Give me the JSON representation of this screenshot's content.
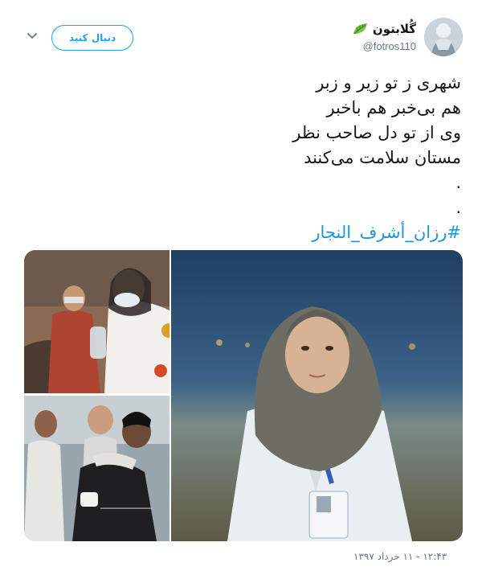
{
  "author": {
    "display_name": "گُلابتون",
    "handle": "@fotros110",
    "badge_icon": "leaf-icon",
    "avatar_icon": "avatar-photo"
  },
  "actions": {
    "follow_label": "دنبال کنید",
    "menu_icon": "chevron-down-icon"
  },
  "tweet": {
    "lines": [
      "شهری ز تو زیر و زبر",
      "هم بی‌خبر هم باخبر",
      "وی از تو دل صاحب نظر",
      "مستان سلامت می‌کنند",
      ".",
      "."
    ],
    "hashtag": "#رزان_أشرف_النجار",
    "timestamp": "۱۲:۴۳ - ۱۱ خرداد ۱۳۹۷"
  },
  "media": {
    "images": [
      "photo-portrait-medic",
      "photo-medic-field",
      "photo-crowd-carrying"
    ]
  },
  "colors": {
    "accent": "#1da1f2",
    "hashtag": "#1b95e0",
    "muted": "#657786",
    "text": "#14171a"
  }
}
